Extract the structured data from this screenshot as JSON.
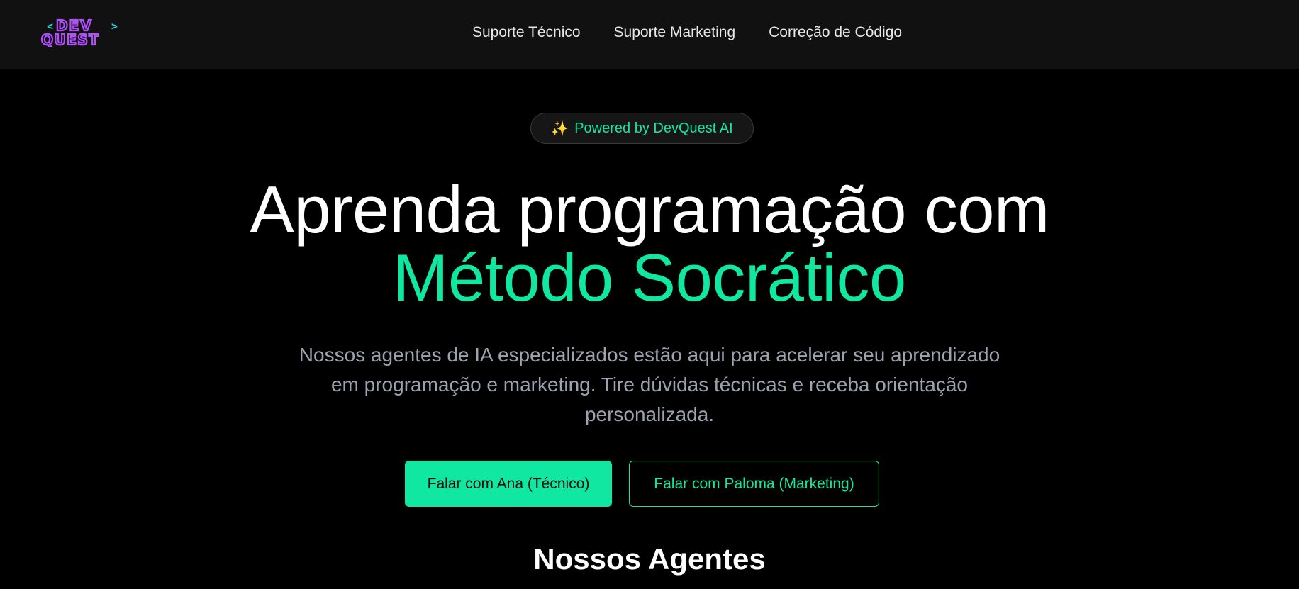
{
  "header": {
    "logo": {
      "line1": "DEV",
      "line2": "QUEST",
      "bracket_left": "<",
      "bracket_right": ">"
    },
    "nav": [
      {
        "label": "Suporte Técnico"
      },
      {
        "label": "Suporte Marketing"
      },
      {
        "label": "Correção de Código"
      }
    ]
  },
  "hero": {
    "badge": {
      "icon": "sparkles-icon",
      "text": "Powered by DevQuest AI"
    },
    "title_line1": "Aprenda programação com",
    "title_line2": "Método Socrático",
    "description": "Nossos agentes de IA especializados estão aqui para acelerar seu aprendizado em programação e marketing. Tire dúvidas técnicas e receba orientação personalizada.",
    "primary_button": "Falar com Ana (Técnico)",
    "secondary_button": "Falar com Paloma (Marketing)"
  },
  "agents_section": {
    "title": "Nossos Agentes"
  },
  "colors": {
    "accent": "#10e7a0",
    "background": "#000000",
    "navbar": "#111111",
    "logo_purple": "#b44cff",
    "logo_cyan": "#2fd6e8"
  }
}
